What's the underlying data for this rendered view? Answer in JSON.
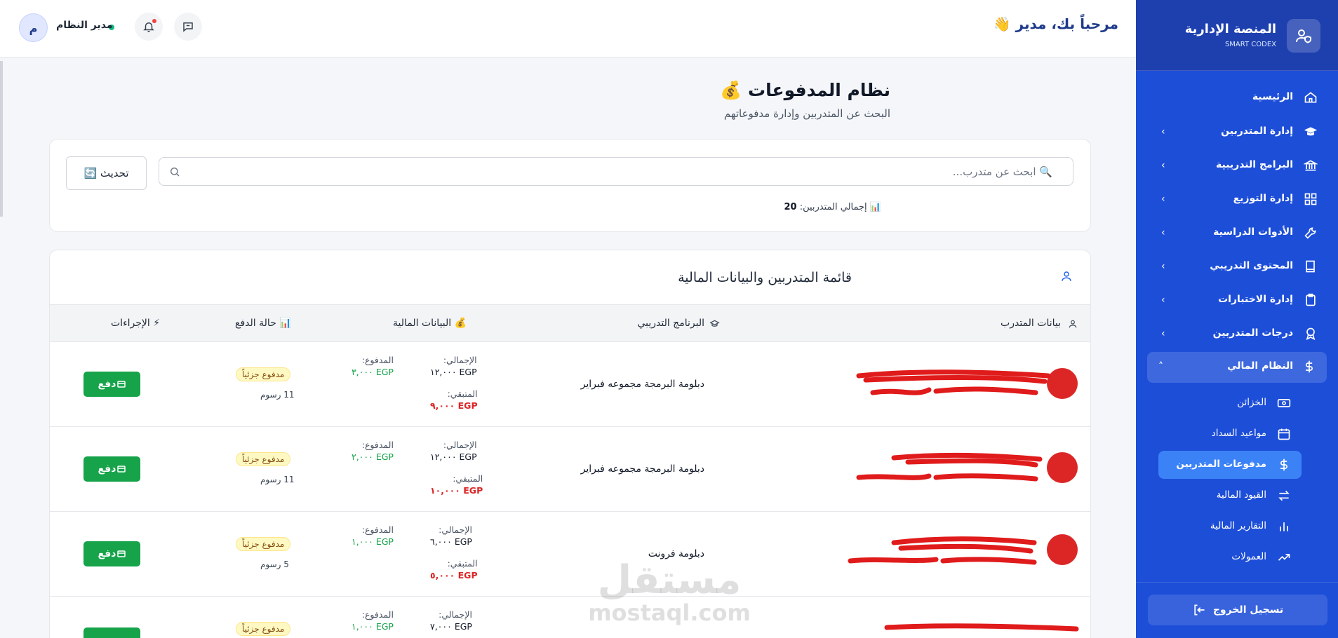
{
  "topbar": {
    "welcome": "مرحباً بك، مدير 👋",
    "admin_name": "مدير النظام",
    "avatar_letter": "م"
  },
  "page": {
    "title": "نظام المدفوعات 💰",
    "subtitle": "البحث عن المتدربين وإدارة مدفوعاتهم"
  },
  "search": {
    "placeholder": "🔍 ابحث عن متدرب...",
    "refresh_label": "🔄 تحديث",
    "total_label": "📊 إجمالي المتدربين:",
    "total_value": "20"
  },
  "list": {
    "title": "قائمة المتدربين والبيانات المالية",
    "columns": {
      "trainee": "بيانات المتدرب",
      "program": "البرنامج التدريبي",
      "financial": "💰 البيانات المالية",
      "status": "📊 حالة الدفع",
      "actions": "⚡ الإجراءات"
    },
    "labels": {
      "total": "الإجمالي:",
      "paid": "المدفوع:",
      "remaining": "المتبقي:",
      "pay": "دفع"
    },
    "rows": [
      {
        "program": "دبلومة البرمجة مجموعه فبراير",
        "total": "EGP ١٢,٠٠٠",
        "paid": "EGP ٣,٠٠٠",
        "remaining": "EGP ٩,٠٠٠",
        "status": "مدفوع جزئياً",
        "fees": "11 رسوم"
      },
      {
        "program": "دبلومة البرمجة مجموعه فبراير",
        "total": "EGP ١٢,٠٠٠",
        "paid": "EGP ٢,٠٠٠",
        "remaining": "EGP ١٠,٠٠٠",
        "status": "مدفوع جزئياً",
        "fees": "11 رسوم"
      },
      {
        "program": "دبلومة فرونت",
        "total": "EGP ٦,٠٠٠",
        "paid": "EGP ١,٠٠٠",
        "remaining": "EGP ٥,٠٠٠",
        "status": "مدفوع جزئياً",
        "fees": "5 رسوم"
      },
      {
        "program": "",
        "total": "EGP ٧,٠٠٠",
        "paid": "EGP ١,٠٠٠",
        "remaining": "",
        "status": "مدفوع جزئياً",
        "fees": ""
      }
    ]
  },
  "watermark": {
    "arabic": "مستقل",
    "latin": "mostaql.com"
  },
  "sidebar": {
    "title": "المنصة الإدارية",
    "subtitle": "SMART CODEX",
    "items": [
      {
        "label": "الرئيسية",
        "icon": "home-icon"
      },
      {
        "label": "إدارة المتدربين",
        "icon": "graduation-cap-icon"
      },
      {
        "label": "البرامج التدريبية",
        "icon": "institution-icon"
      },
      {
        "label": "إدارة التوزيع",
        "icon": "grid-icon"
      },
      {
        "label": "الأدوات الدراسية",
        "icon": "wrench-icon"
      },
      {
        "label": "المحتوى التدريبي",
        "icon": "book-icon"
      },
      {
        "label": "إدارة الاختبارات",
        "icon": "clipboard-icon"
      },
      {
        "label": "درجات المتدربين",
        "icon": "award-icon"
      },
      {
        "label": "النظام المالي",
        "icon": "dollar-icon"
      }
    ],
    "subitems": [
      {
        "label": "الخزائن",
        "icon": "banknote-icon"
      },
      {
        "label": "مواعيد السداد",
        "icon": "calendar-icon"
      },
      {
        "label": "مدفوعات المتدربين",
        "icon": "dollar-icon"
      },
      {
        "label": "القيود المالية",
        "icon": "transfer-icon"
      },
      {
        "label": "التقارير المالية",
        "icon": "bar-chart-icon"
      },
      {
        "label": "العمولات",
        "icon": "trending-up-icon"
      }
    ],
    "logout": "تسجيل الخروج"
  },
  "colors": {
    "sidebar": "#1d4ed8",
    "pay_button": "#16a34a",
    "paid_text": "#16a34a",
    "remaining_text": "#dc2626"
  }
}
